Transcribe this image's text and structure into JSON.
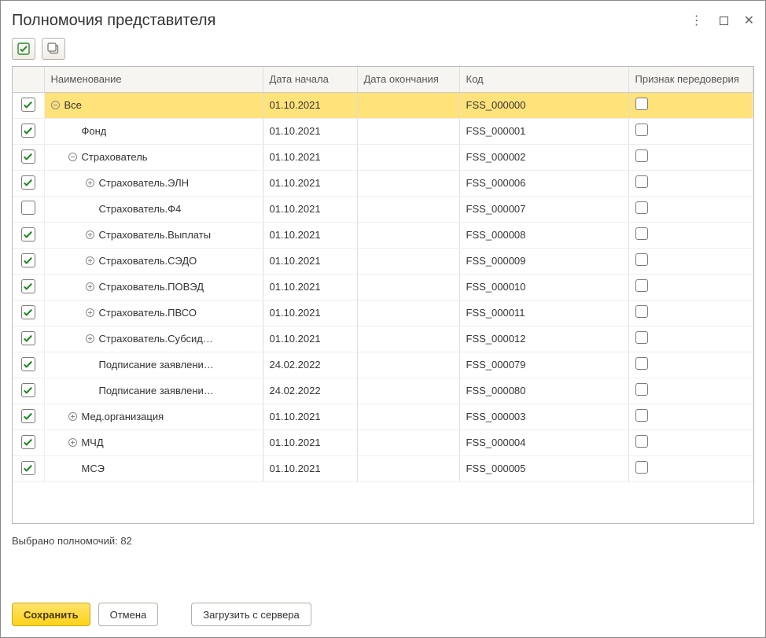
{
  "window": {
    "title": "Полномочия представителя"
  },
  "columns": {
    "name": "Наименование",
    "start": "Дата начала",
    "end": "Дата окончания",
    "code": "Код",
    "redel": "Признак передоверия"
  },
  "rows": [
    {
      "checked": true,
      "indent": 0,
      "expander": "minus",
      "name": "Все",
      "start": "01.10.2021",
      "end": "",
      "code": "FSS_000000",
      "redel": false,
      "selected": true
    },
    {
      "checked": true,
      "indent": 1,
      "expander": "none",
      "name": "Фонд",
      "start": "01.10.2021",
      "end": "",
      "code": "FSS_000001",
      "redel": false
    },
    {
      "checked": true,
      "indent": 1,
      "expander": "minus",
      "name": "Страхователь",
      "start": "01.10.2021",
      "end": "",
      "code": "FSS_000002",
      "redel": false
    },
    {
      "checked": true,
      "indent": 2,
      "expander": "plus",
      "name": "Страхователь.ЭЛН",
      "start": "01.10.2021",
      "end": "",
      "code": "FSS_000006",
      "redel": false
    },
    {
      "checked": false,
      "indent": 2,
      "expander": "none",
      "name": "Страхователь.Ф4",
      "start": "01.10.2021",
      "end": "",
      "code": "FSS_000007",
      "redel": false
    },
    {
      "checked": true,
      "indent": 2,
      "expander": "plus",
      "name": "Страхователь.Выплаты",
      "start": "01.10.2021",
      "end": "",
      "code": "FSS_000008",
      "redel": false
    },
    {
      "checked": true,
      "indent": 2,
      "expander": "plus",
      "name": "Страхователь.СЭДО",
      "start": "01.10.2021",
      "end": "",
      "code": "FSS_000009",
      "redel": false
    },
    {
      "checked": true,
      "indent": 2,
      "expander": "plus",
      "name": "Страхователь.ПОВЭД",
      "start": "01.10.2021",
      "end": "",
      "code": "FSS_000010",
      "redel": false
    },
    {
      "checked": true,
      "indent": 2,
      "expander": "plus",
      "name": "Страхователь.ПВСО",
      "start": "01.10.2021",
      "end": "",
      "code": "FSS_000011",
      "redel": false
    },
    {
      "checked": true,
      "indent": 2,
      "expander": "plus",
      "name": "Страхователь.Субсид…",
      "start": "01.10.2021",
      "end": "",
      "code": "FSS_000012",
      "redel": false
    },
    {
      "checked": true,
      "indent": 2,
      "expander": "none",
      "name": "Подписание заявлени…",
      "start": "24.02.2022",
      "end": "",
      "code": "FSS_000079",
      "redel": false
    },
    {
      "checked": true,
      "indent": 2,
      "expander": "none",
      "name": "Подписание заявлени…",
      "start": "24.02.2022",
      "end": "",
      "code": "FSS_000080",
      "redel": false
    },
    {
      "checked": true,
      "indent": 1,
      "expander": "plus",
      "name": "Мед.организация",
      "start": "01.10.2021",
      "end": "",
      "code": "FSS_000003",
      "redel": false
    },
    {
      "checked": true,
      "indent": 1,
      "expander": "plus",
      "name": "МЧД",
      "start": "01.10.2021",
      "end": "",
      "code": "FSS_000004",
      "redel": false
    },
    {
      "checked": true,
      "indent": 1,
      "expander": "none",
      "name": "МСЭ",
      "start": "01.10.2021",
      "end": "",
      "code": "FSS_000005",
      "redel": false
    }
  ],
  "status": {
    "text": "Выбрано полномочий: 82"
  },
  "buttons": {
    "save": "Сохранить",
    "cancel": "Отмена",
    "load": "Загрузить с сервера"
  }
}
